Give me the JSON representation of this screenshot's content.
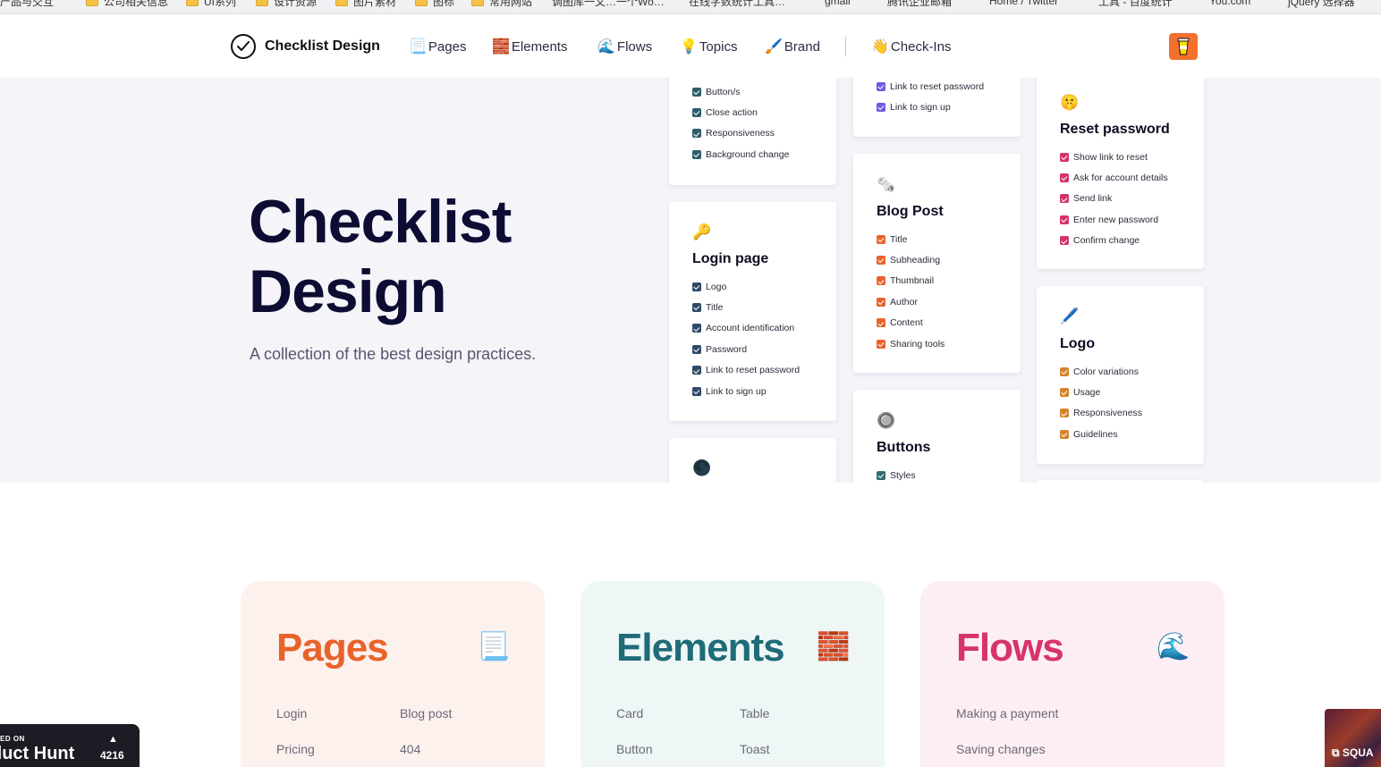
{
  "bookmarks": [
    "产品与交互",
    "公司相关信息",
    "UI系列",
    "设计资源",
    "图片素材",
    "图标",
    "常用网站",
    "调图库一文…一个Wo…",
    "在线字数统计工具…",
    "gmail",
    "腾讯企业邮箱",
    "Home / Twitter",
    "工具 - 百度统计",
    "You.com",
    "jQuery 选择器"
  ],
  "nav": {
    "brand": "Checklist Design",
    "links": [
      {
        "icon": "📃",
        "label": "Pages"
      },
      {
        "icon": "🧱",
        "label": "Elements"
      },
      {
        "icon": "🌊",
        "label": "Flows"
      },
      {
        "icon": "💡",
        "label": "Topics"
      },
      {
        "icon": "🖌️",
        "label": "Brand"
      },
      {
        "icon": "👋",
        "label": "Check-Ins"
      }
    ]
  },
  "hero": {
    "title_line1": "Checklist",
    "title_line2": "Design",
    "subtitle": "A collection of the best design practices."
  },
  "cards": {
    "top_left": {
      "items": [
        "Button/s",
        "Close action",
        "Responsiveness",
        "Background change"
      ],
      "color": "#2e5e6b"
    },
    "login": {
      "emoji": "🔑",
      "title": "Login page",
      "items": [
        "Logo",
        "Title",
        "Account identification",
        "Password",
        "Link to reset password",
        "Link to sign up"
      ],
      "color": "#2e4a66"
    },
    "bottom_left": {
      "emoji": "🌑"
    },
    "top_mid": {
      "items": [
        "Link to reset password",
        "Link to sign up"
      ],
      "color": "#6e5ae6"
    },
    "blog": {
      "emoji": "🗞️",
      "title": "Blog Post",
      "items": [
        "Title",
        "Subheading",
        "Thumbnail",
        "Author",
        "Content",
        "Sharing tools"
      ],
      "color": "#e8632b"
    },
    "buttons": {
      "emoji": "🔘",
      "title": "Buttons",
      "items": [
        "Styles"
      ],
      "color": "#2e6b6b"
    },
    "reset": {
      "emoji": "🤫",
      "title": "Reset password",
      "items": [
        "Show link to reset",
        "Ask for account details",
        "Send link",
        "Enter new password",
        "Confirm change"
      ],
      "color": "#d6336c"
    },
    "logo": {
      "emoji": "🖊️",
      "title": "Logo",
      "items": [
        "Color variations",
        "Usage",
        "Responsiveness",
        "Guidelines"
      ],
      "color": "#d6842b"
    }
  },
  "tiles": {
    "pages": {
      "title": "Pages",
      "icon": "📃",
      "color": "#e8632b",
      "bg": "#fdf1ee",
      "items": [
        "Login",
        "Blog post",
        "Pricing",
        "404"
      ]
    },
    "elements": {
      "title": "Elements",
      "icon": "🧱",
      "color": "#1f6b78",
      "bg": "#eef7f6",
      "items": [
        "Card",
        "Table",
        "Button",
        "Toast"
      ]
    },
    "flows": {
      "title": "Flows",
      "icon": "🌊",
      "color": "#d6336c",
      "bg": "#fdeef3",
      "items": [
        "Making a payment",
        "Saving changes"
      ]
    }
  },
  "producthunt": {
    "featured": "ED ON",
    "name": "duct Hunt",
    "arrow": "▲",
    "count": "4216"
  },
  "squad": {
    "label": "SQUA"
  }
}
